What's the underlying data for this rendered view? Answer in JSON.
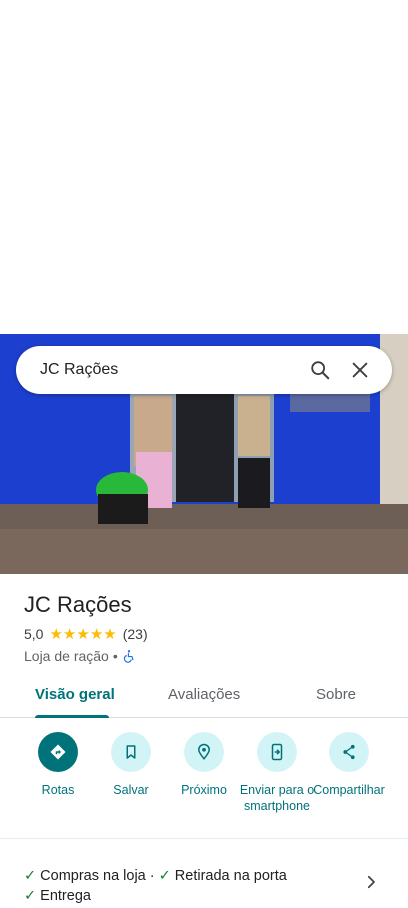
{
  "search": {
    "query": "JC Rações"
  },
  "place": {
    "name": "JC Rações",
    "rating": "5,0",
    "stars": [
      "★",
      "★",
      "★",
      "★",
      "★"
    ],
    "review_count": "(23)",
    "category": "Loja de ração",
    "separator": "•"
  },
  "tabs": [
    {
      "label": "Visão geral"
    },
    {
      "label": "Avaliações"
    },
    {
      "label": "Sobre"
    }
  ],
  "actions": [
    {
      "label": "Rotas",
      "icon": "directions-icon"
    },
    {
      "label": "Salvar",
      "icon": "bookmark-icon"
    },
    {
      "label": "Próximo",
      "icon": "nearby-icon"
    },
    {
      "label": "Enviar para o smartphone",
      "icon": "send-to-phone-icon"
    },
    {
      "label": "Compartilhar",
      "icon": "share-icon"
    }
  ],
  "services": {
    "items": [
      "Compras na loja",
      "Retirada na porta",
      "Entrega"
    ],
    "separator": "·"
  },
  "colors": {
    "accent": "#00737a",
    "accent_light": "#d3f4f7",
    "star": "#fbbc04",
    "check": "#188038"
  }
}
